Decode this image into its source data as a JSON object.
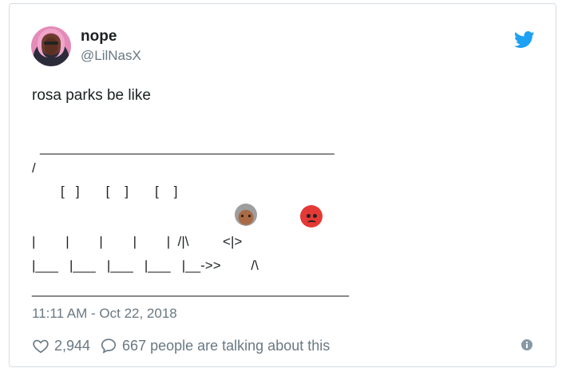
{
  "tweet": {
    "author_name": "nope",
    "author_handle": "@LilNasX",
    "text": "rosa parks be like",
    "ascii_art": {
      "line_top": "_______________________________________",
      "slash": "/",
      "windows": "[   ]       [    ]       [    ]",
      "bars": "|        |        |        |        |  /|\\         <|>",
      "bottom": "|___   |___   |___   |___   |__->>        /\\",
      "underline": "__________________________________________"
    },
    "emojis": [
      "older-woman-emoji",
      "angry-face-emoji"
    ],
    "timestamp": "11:11 AM - Oct 22, 2018",
    "likes": "2,944",
    "replies_text": "667 people are talking about this"
  },
  "colors": {
    "text": "#1c2022",
    "muted": "#697882",
    "twitter_blue": "#1da1f2",
    "border": "#d6dde2"
  },
  "icons": [
    "twitter-bird-icon",
    "heart-icon",
    "reply-bubble-icon",
    "info-icon"
  ]
}
